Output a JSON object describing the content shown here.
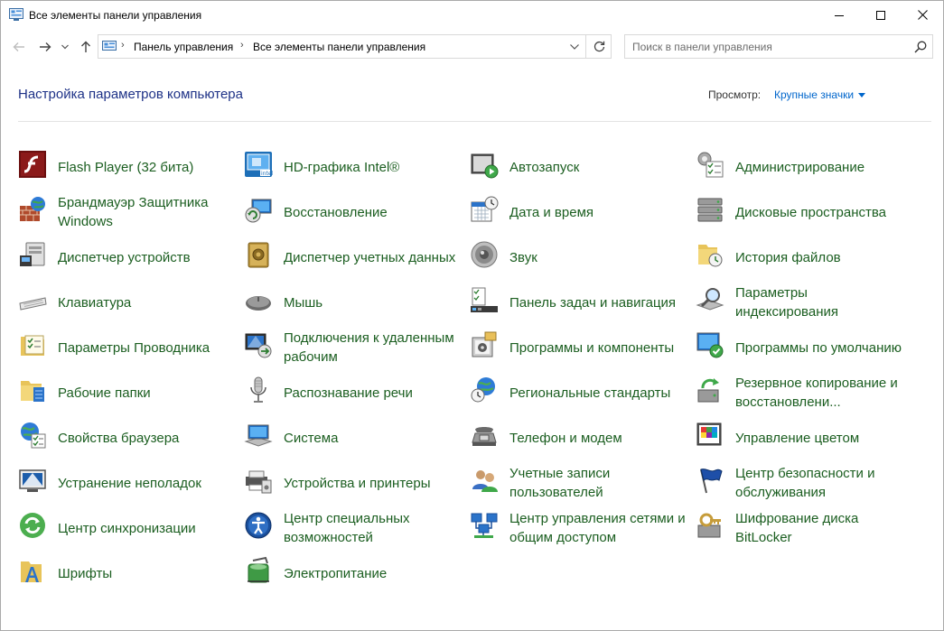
{
  "window": {
    "title": "Все элементы панели управления",
    "buttons": {
      "minimize": "minimize",
      "maximize": "maximize",
      "close": "close"
    }
  },
  "nav": {
    "breadcrumb": [
      "Панель управления",
      "Все элементы панели управления"
    ],
    "search_placeholder": "Поиск в панели управления"
  },
  "header": {
    "title": "Настройка параметров компьютера",
    "view_by_label": "Просмотр:",
    "view_by_value": "Крупные значки"
  },
  "items": [
    {
      "label": "Flash Player (32 бита)",
      "icon": "flash-icon"
    },
    {
      "label": "Брандмауэр Защитника Windows",
      "icon": "firewall-icon"
    },
    {
      "label": "Диспетчер устройств",
      "icon": "device-manager-icon"
    },
    {
      "label": "Клавиатура",
      "icon": "keyboard-icon"
    },
    {
      "label": "Параметры Проводника",
      "icon": "folder-options-icon"
    },
    {
      "label": "Рабочие папки",
      "icon": "work-folders-icon"
    },
    {
      "label": "Свойства браузера",
      "icon": "internet-options-icon"
    },
    {
      "label": "Устранение неполадок",
      "icon": "troubleshooting-icon"
    },
    {
      "label": "Центр синхронизации",
      "icon": "sync-center-icon"
    },
    {
      "label": "Шрифты",
      "icon": "fonts-icon"
    },
    {
      "label": "HD-графика Intel®",
      "icon": "intel-graphics-icon"
    },
    {
      "label": "Восстановление",
      "icon": "recovery-icon"
    },
    {
      "label": "Диспетчер учетных данных",
      "icon": "credential-manager-icon"
    },
    {
      "label": "Мышь",
      "icon": "mouse-icon"
    },
    {
      "label": "Подключения к удаленным рабочим",
      "icon": "remote-desktop-icon"
    },
    {
      "label": "Распознавание речи",
      "icon": "speech-recognition-icon"
    },
    {
      "label": "Система",
      "icon": "system-icon"
    },
    {
      "label": "Устройства и принтеры",
      "icon": "devices-printers-icon"
    },
    {
      "label": "Центр специальных возможностей",
      "icon": "ease-of-access-icon"
    },
    {
      "label": "Электропитание",
      "icon": "power-options-icon"
    },
    {
      "label": "Автозапуск",
      "icon": "autoplay-icon"
    },
    {
      "label": "Дата и время",
      "icon": "date-time-icon"
    },
    {
      "label": "Звук",
      "icon": "sound-icon"
    },
    {
      "label": "Панель задач и навигация",
      "icon": "taskbar-icon"
    },
    {
      "label": "Программы и компоненты",
      "icon": "programs-features-icon"
    },
    {
      "label": "Региональные стандарты",
      "icon": "region-icon"
    },
    {
      "label": "Телефон и модем",
      "icon": "phone-modem-icon"
    },
    {
      "label": "Учетные записи пользователей",
      "icon": "user-accounts-icon"
    },
    {
      "label": "Центр управления сетями и общим доступом",
      "icon": "network-sharing-icon"
    },
    {
      "label": "Администрирование",
      "icon": "admin-tools-icon"
    },
    {
      "label": "Дисковые пространства",
      "icon": "storage-spaces-icon"
    },
    {
      "label": "История файлов",
      "icon": "file-history-icon"
    },
    {
      "label": "Параметры индексирования",
      "icon": "indexing-icon"
    },
    {
      "label": "Программы по умолчанию",
      "icon": "default-programs-icon"
    },
    {
      "label": "Резервное копирование и восстановлени...",
      "icon": "backup-restore-icon"
    },
    {
      "label": "Управление цветом",
      "icon": "color-management-icon"
    },
    {
      "label": "Центр безопасности и обслуживания",
      "icon": "security-maintenance-icon"
    },
    {
      "label": "Шифрование диска BitLocker",
      "icon": "bitlocker-icon"
    }
  ]
}
